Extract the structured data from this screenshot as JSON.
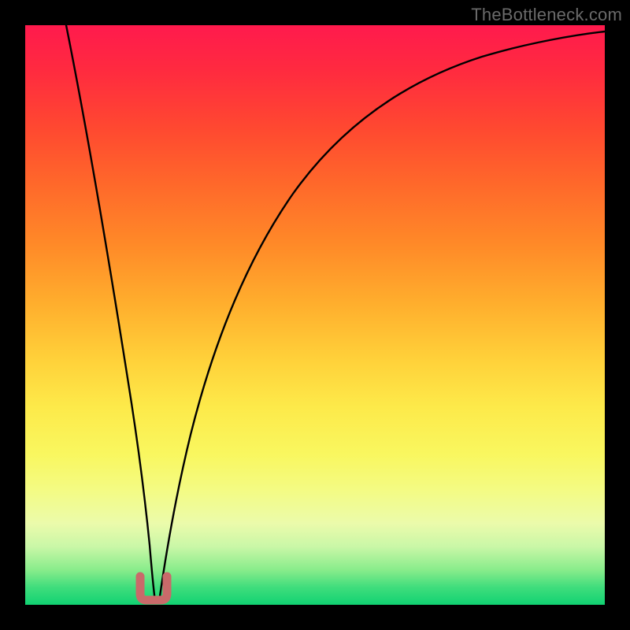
{
  "watermark": {
    "text": "TheBottleneck.com"
  },
  "chart_data": {
    "type": "line",
    "title": "",
    "xlabel": "",
    "ylabel": "",
    "xlim": [
      0,
      100
    ],
    "ylim": [
      0,
      100
    ],
    "grid": false,
    "legend": false,
    "series": [
      {
        "name": "curve",
        "x": [
          7,
          9,
          11,
          13,
          15,
          17,
          18.5,
          19.5,
          20.5,
          21.5,
          22.5,
          24,
          26,
          29,
          33,
          38,
          44,
          51,
          59,
          68,
          78,
          89,
          100
        ],
        "y": [
          100,
          88,
          76,
          64,
          52,
          40,
          30,
          22,
          14,
          6,
          0,
          6,
          18,
          32,
          44,
          54,
          62,
          69,
          75,
          80,
          84,
          87,
          89
        ]
      }
    ],
    "marker": {
      "name": "min-bracket",
      "x_range": [
        19.5,
        23.5
      ],
      "y": 2
    },
    "background_gradient": {
      "top": "#ff1a4d",
      "mid": "#ffd23a",
      "bottom": "#11d272"
    }
  }
}
